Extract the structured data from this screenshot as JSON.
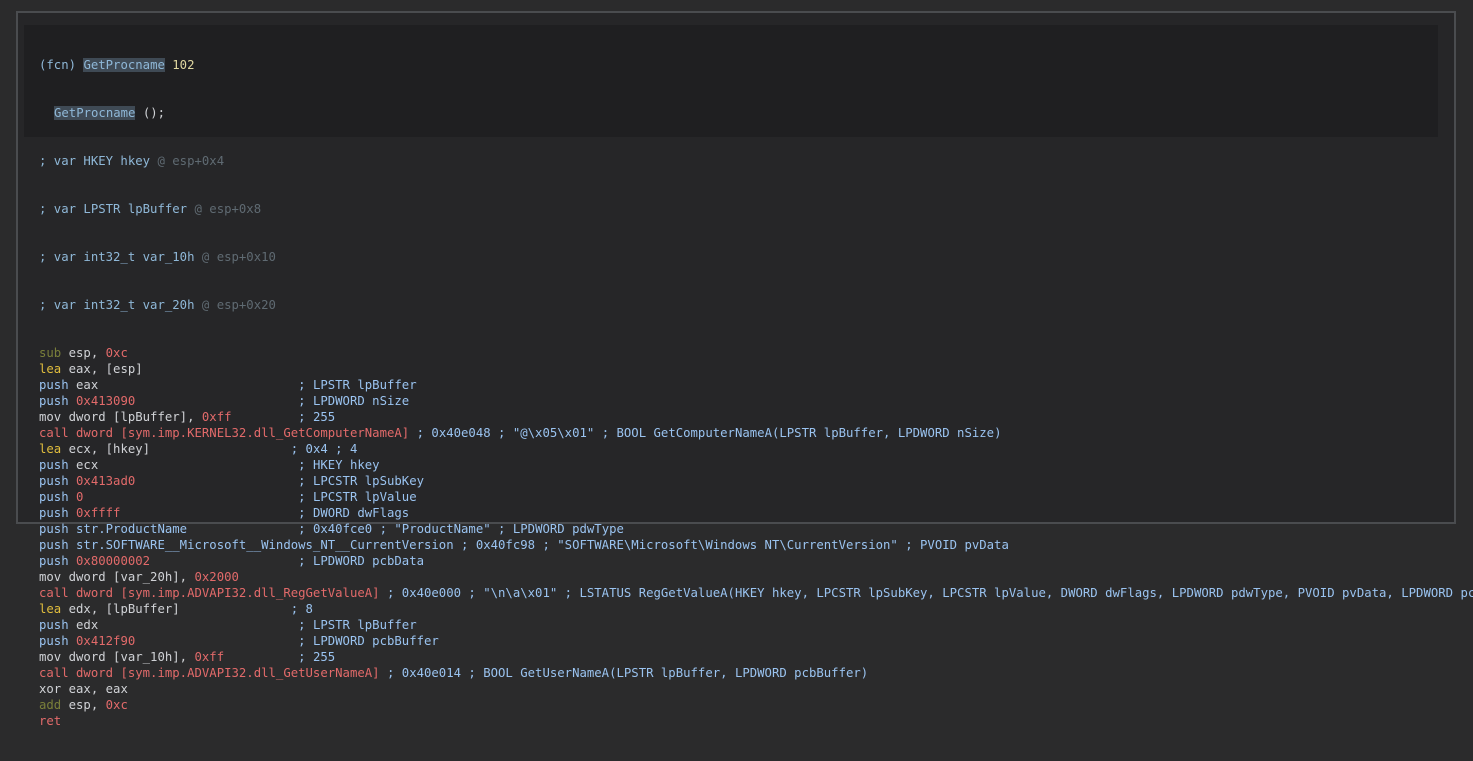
{
  "function": {
    "prefix": "(fcn)",
    "name": "GetProcname",
    "size": "102",
    "signature_name": "GetProcname",
    "signature_rest": " ();"
  },
  "vars": [
    {
      "decl": "; var HKEY hkey",
      "loc": "@ esp+0x4"
    },
    {
      "decl": "; var LPSTR lpBuffer",
      "loc": "@ esp+0x8"
    },
    {
      "decl": "; var int32_t var_10h",
      "loc": "@ esp+0x10"
    },
    {
      "decl": "; var int32_t var_20h",
      "loc": "@ esp+0x20"
    }
  ],
  "lines": [
    {
      "mn": "sub",
      "cls": "mn-sub",
      "ops": [
        {
          "t": " esp, ",
          "c": "op"
        },
        {
          "t": "0xc",
          "c": "imm"
        }
      ],
      "cmt": ""
    },
    {
      "mn": "lea",
      "cls": "mn-lea",
      "ops": [
        {
          "t": " eax, [esp]",
          "c": "op"
        }
      ],
      "cmt": ""
    },
    {
      "mn": "push",
      "cls": "mn-push",
      "ops": [
        {
          "t": " eax                           ",
          "c": "op"
        }
      ],
      "cmt": "; LPSTR lpBuffer"
    },
    {
      "mn": "push",
      "cls": "mn-push",
      "ops": [
        {
          "t": " 0x413090",
          "c": "imm"
        },
        {
          "t": "                      ",
          "c": "op"
        }
      ],
      "cmt": "; LPDWORD nSize"
    },
    {
      "mn": "mov",
      "cls": "mn-mov",
      "ops": [
        {
          "t": " dword [lpBuffer], ",
          "c": "op"
        },
        {
          "t": "0xff",
          "c": "imm"
        },
        {
          "t": "         ",
          "c": "op"
        }
      ],
      "cmt": "; 255"
    },
    {
      "mn": "call",
      "cls": "mn-call",
      "ops": [
        {
          "t": " dword [",
          "c": "sym-link"
        },
        {
          "t": "sym.imp.KERNEL32.dll_GetComputerNameA",
          "c": "sym-link"
        },
        {
          "t": "]",
          "c": "sym-link"
        }
      ],
      "cmt": " ; 0x40e048 ; \"@\\x05\\x01\" ; BOOL GetComputerNameA(LPSTR lpBuffer, LPDWORD nSize)"
    },
    {
      "mn": "lea",
      "cls": "mn-lea",
      "ops": [
        {
          "t": " ecx, [hkey]                  ",
          "c": "op"
        }
      ],
      "cmt": " ; 0x4 ; 4"
    },
    {
      "mn": "push",
      "cls": "mn-push",
      "ops": [
        {
          "t": " ecx                           ",
          "c": "op"
        }
      ],
      "cmt": "; HKEY hkey"
    },
    {
      "mn": "push",
      "cls": "mn-push",
      "ops": [
        {
          "t": " 0x413ad0",
          "c": "imm"
        },
        {
          "t": "                      ",
          "c": "op"
        }
      ],
      "cmt": "; LPCSTR lpSubKey"
    },
    {
      "mn": "push",
      "cls": "mn-push",
      "ops": [
        {
          "t": " 0",
          "c": "imm"
        },
        {
          "t": "                             ",
          "c": "op"
        }
      ],
      "cmt": "; LPCSTR lpValue"
    },
    {
      "mn": "push",
      "cls": "mn-push",
      "ops": [
        {
          "t": " 0xffff",
          "c": "imm"
        },
        {
          "t": "                        ",
          "c": "op"
        }
      ],
      "cmt": "; DWORD dwFlags"
    },
    {
      "mn": "push",
      "cls": "mn-push",
      "ops": [
        {
          "t": " str.ProductName",
          "c": "mn-push"
        },
        {
          "t": "               ",
          "c": "op"
        }
      ],
      "cmt": "; 0x40fce0 ; \"ProductName\" ; LPDWORD pdwType"
    },
    {
      "mn": "push",
      "cls": "mn-push",
      "ops": [
        {
          "t": " str.SOFTWARE__Microsoft__Windows_NT__CurrentVersion",
          "c": "mn-push"
        }
      ],
      "cmt": " ; 0x40fc98 ; \"SOFTWARE\\Microsoft\\Windows NT\\CurrentVersion\" ; PVOID pvData"
    },
    {
      "mn": "push",
      "cls": "mn-push",
      "ops": [
        {
          "t": " 0x80000002",
          "c": "imm"
        },
        {
          "t": "                    ",
          "c": "op"
        }
      ],
      "cmt": "; LPDWORD pcbData"
    },
    {
      "mn": "mov",
      "cls": "mn-mov",
      "ops": [
        {
          "t": " dword [var_20h], ",
          "c": "op"
        },
        {
          "t": "0x2000",
          "c": "imm"
        }
      ],
      "cmt": ""
    },
    {
      "mn": "call",
      "cls": "mn-call",
      "ops": [
        {
          "t": " dword [sym.imp.ADVAPI32.dll_RegGetValueA]",
          "c": "sym-link"
        }
      ],
      "cmt": " ; 0x40e000 ; \"\\n\\a\\x01\" ; LSTATUS RegGetValueA(HKEY hkey, LPCSTR lpSubKey, LPCSTR lpValue, DWORD dwFlags, LPDWORD pdwType, PVOID pvData, LPDWORD pcbData)"
    },
    {
      "mn": "lea",
      "cls": "mn-lea",
      "ops": [
        {
          "t": " edx, [lpBuffer]              ",
          "c": "op"
        }
      ],
      "cmt": " ; 8"
    },
    {
      "mn": "push",
      "cls": "mn-push",
      "ops": [
        {
          "t": " edx                           ",
          "c": "op"
        }
      ],
      "cmt": "; LPSTR lpBuffer"
    },
    {
      "mn": "push",
      "cls": "mn-push",
      "ops": [
        {
          "t": " 0x412f90",
          "c": "imm"
        },
        {
          "t": "                      ",
          "c": "op"
        }
      ],
      "cmt": "; LPDWORD pcbBuffer"
    },
    {
      "mn": "mov",
      "cls": "mn-mov",
      "ops": [
        {
          "t": " dword [var_10h], ",
          "c": "op"
        },
        {
          "t": "0xff",
          "c": "imm"
        },
        {
          "t": "          ",
          "c": "op"
        }
      ],
      "cmt": "; 255"
    },
    {
      "mn": "call",
      "cls": "mn-call",
      "ops": [
        {
          "t": " dword [sym.imp.ADVAPI32.dll_GetUserNameA]",
          "c": "sym-link"
        }
      ],
      "cmt": " ; 0x40e014 ; BOOL GetUserNameA(LPSTR lpBuffer, LPDWORD pcbBuffer)"
    },
    {
      "mn": "xor",
      "cls": "mn-xor",
      "ops": [
        {
          "t": " eax, eax",
          "c": "op"
        }
      ],
      "cmt": ""
    },
    {
      "mn": "add",
      "cls": "mn-sub",
      "ops": [
        {
          "t": " esp, ",
          "c": "op"
        },
        {
          "t": "0xc",
          "c": "imm"
        }
      ],
      "cmt": ""
    },
    {
      "mn": "ret",
      "cls": "mn-ret",
      "ops": [],
      "cmt": ""
    }
  ]
}
